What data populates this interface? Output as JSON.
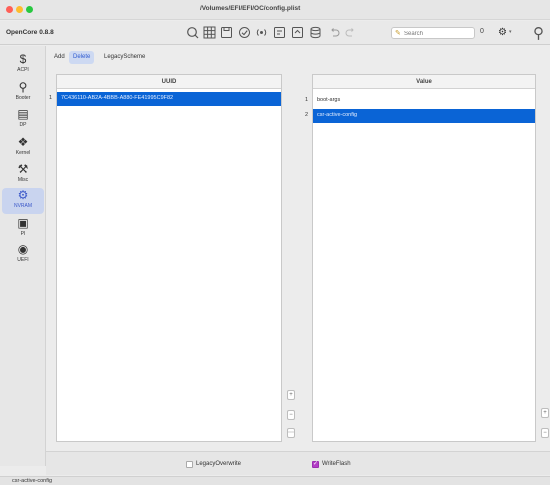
{
  "window": {
    "title": "/Volumes/EFI/EFI/OC/config.plist"
  },
  "toolbar": {
    "app_name": "OpenCore 0.8.8",
    "icons": [
      "magnifier-icon",
      "grid-icon",
      "save-icon",
      "check-icon",
      "radio-icon",
      "import-icon",
      "export-icon",
      "database-icon",
      "undo-icon",
      "redo-icon"
    ],
    "search_placeholder": "Search",
    "stepper_value": "0"
  },
  "sidebar": {
    "items": [
      {
        "label": "ACPI",
        "icon": "$"
      },
      {
        "label": "Booter",
        "icon": "⚲"
      },
      {
        "label": "DP",
        "icon": "▤"
      },
      {
        "label": "Kernel",
        "icon": "❖"
      },
      {
        "label": "Misc",
        "icon": "⚒"
      },
      {
        "label": "NVRAM",
        "icon": "⚙"
      },
      {
        "label": "PI",
        "icon": "▣"
      },
      {
        "label": "UEFI",
        "icon": "◉"
      }
    ],
    "active_index": 5,
    "accent_color": "#3a57c8"
  },
  "tabs": [
    {
      "label": "Add"
    },
    {
      "label": "Delete"
    },
    {
      "label": "LegacyScheme"
    }
  ],
  "left_table": {
    "header": "UUID",
    "rows": [
      {
        "index": "1",
        "value": "7C436110-AB2A-4BBB-A880-FE41995C9F82"
      }
    ]
  },
  "right_table": {
    "header": "Value",
    "rows": [
      {
        "index": "1",
        "value": "boot-args"
      },
      {
        "index": "2",
        "value": "csr-active-config"
      }
    ]
  },
  "side_buttons": {
    "add": "+",
    "remove": "−",
    "more": "⋯"
  },
  "bottom": {
    "legacy_overwrite_label": "LegacyOverwrite",
    "legacy_overwrite_checked": false,
    "write_flash_label": "WriteFlash",
    "write_flash_checked": true
  },
  "status": {
    "text": "csr-active-config"
  },
  "colors": {
    "selection": "#0a64d6",
    "checkbox_on": "#b33dc6"
  }
}
